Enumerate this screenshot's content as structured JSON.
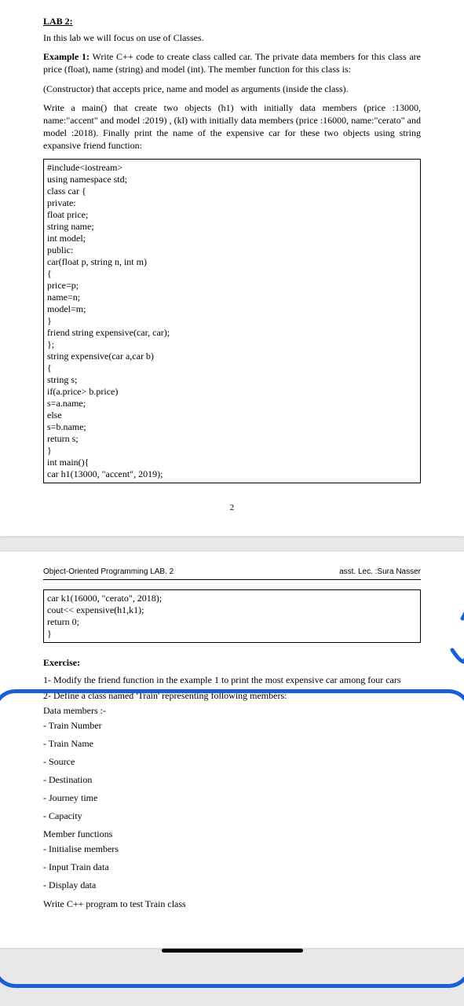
{
  "lab_title": "LAB 2:",
  "intro": "In this lab we will focus on use of Classes.",
  "example_lead": "Example 1:",
  "example_rest": " Write C++ code to create class called car. The private data members for this class are price (float), name (string) and model (int). The member function for this class is:",
  "ctor": "(Constructor) that accepts price, name and model as arguments (inside the class).",
  "mainpara": "Write a main() that create two objects (h1) with initially data members (price :13000, name:\"accent\" and model :2019) , (kl) with initially data members (price :16000, name:\"cerato\" and model :2018). Finally print the name of the expensive car for these two objects using string expansive friend function:",
  "code1": [
    "#include<iostream>",
    "using namespace std;",
    "class car {",
    "private:",
    "float price;",
    "string name;",
    "int model;",
    "public:",
    "car(float p, string n, int m)",
    "{",
    "price=p;",
    "name=n;",
    "model=m;",
    "}",
    "friend string expensive(car, car);",
    "};",
    "string expensive(car a,car b)",
    "{",
    "string s;",
    "if(a.price> b.price)",
    "s=a.name;",
    "else",
    "s=b.name;",
    "return s;",
    "}",
    "int main(){",
    "car h1(13000, \"accent\", 2019);"
  ],
  "pagenum": "2",
  "hdr_left": "Object-Oriented Programming LAB. 2",
  "hdr_right": "asst. Lec. :Sura Nasser",
  "code2": [
    "car k1(16000, \"cerato\", 2018);",
    "cout<< expensive(h1,k1);",
    "return 0;",
    "}"
  ],
  "ex_title": "Exercise:",
  "ex1_lead": "1-  ",
  "ex1_text": "Modify the friend function in the example 1 to print the most expensive car among four cars",
  "ex2_lead": "2-  ",
  "ex2_text": "Define a class named 'Train' representing following members:",
  "data_members": "Data members :-",
  "dm": [
    "-  Train Number",
    "-  Train Name",
    "-  Source",
    "-  Destination",
    "-  Journey time",
    "-  Capacity"
  ],
  "mf_label": "Member functions",
  "mf": [
    "-  Initialise members",
    "-  Input Train data",
    "-  Display data"
  ],
  "final": "Write C++ program to test Train class"
}
